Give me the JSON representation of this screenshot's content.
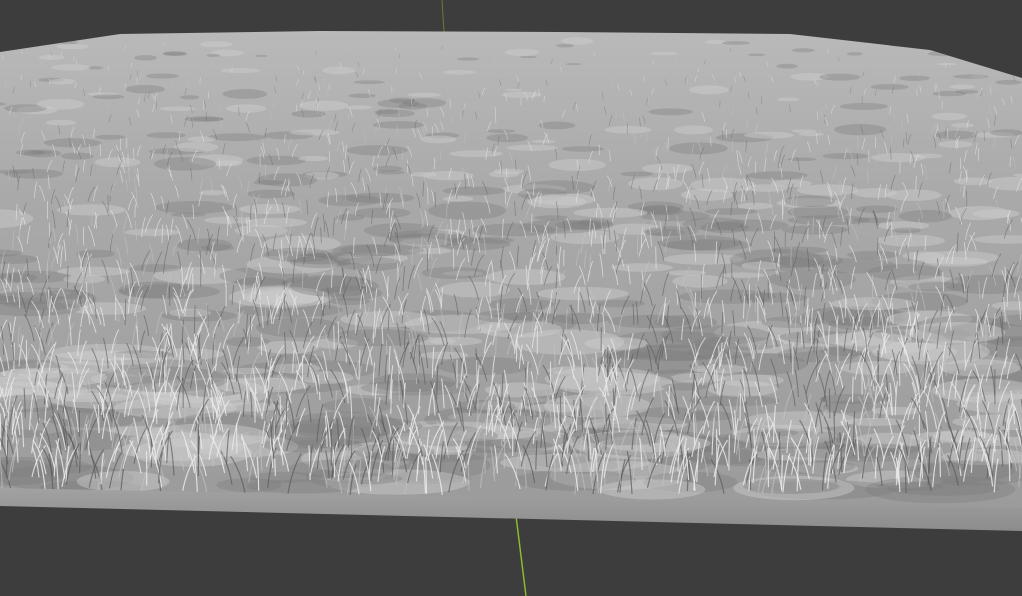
{
  "viewport": {
    "background_color": "#3d3d3d",
    "grid_axis_y_color": "#8fbf2a",
    "grid_axis_z_color": "#6a7a33"
  },
  "object": {
    "type": "grass-hair-particle-plane",
    "surface_color": "#a6a6a6",
    "slab_color": "#9a9a9a",
    "strand_light_color": "#e0e0e0",
    "strand_dark_color": "#5a5a5a"
  }
}
